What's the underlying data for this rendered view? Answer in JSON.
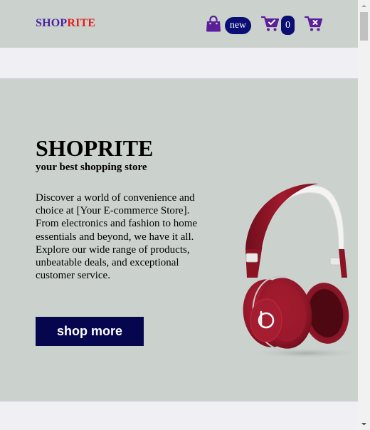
{
  "header": {
    "logo_part1": "SHOP",
    "logo_part2": "RITE",
    "new_badge": "new",
    "cart_count": "0",
    "icons": [
      "shopping-bag-icon",
      "cart-check-icon",
      "cart-remove-icon"
    ],
    "colors": {
      "logo_shop": "#4a1fa0",
      "logo_rite": "#e0201b",
      "badge_bg": "#0b0e73",
      "icon_purple": "#5b1f9a"
    }
  },
  "hero": {
    "title": "SHOPRITE",
    "subtitle": "your best shopping store",
    "description": "Discover a world of convenience and choice at [Your E-commerce Store]. From electronics and fashion to home essentials and beyond, we have it all. Explore our wide range of products, unbeatable deals, and exceptional customer service.",
    "button_label": "shop more",
    "image": "red-headphones",
    "colors": {
      "background": "#cbd2cd",
      "button_bg": "#06064f"
    }
  }
}
